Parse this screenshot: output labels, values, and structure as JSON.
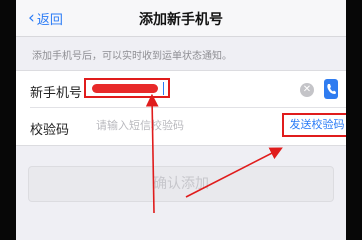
{
  "nav": {
    "back_label": "返回",
    "title": "添加新手机号"
  },
  "hint": "添加手机号后，可以实时收到运单状态通知。",
  "form": {
    "phone": {
      "label": "新手机号",
      "clear_icon": "clear-circle-icon",
      "contact_icon": "contact-book-icon"
    },
    "code": {
      "label": "校验码",
      "placeholder": "请输入短信校验码",
      "send_label": "发送校验码"
    }
  },
  "confirm_label": "确认添加",
  "colors": {
    "accent": "#2a7bf6",
    "highlight": "#e01c1c",
    "background": "#efeff4"
  }
}
